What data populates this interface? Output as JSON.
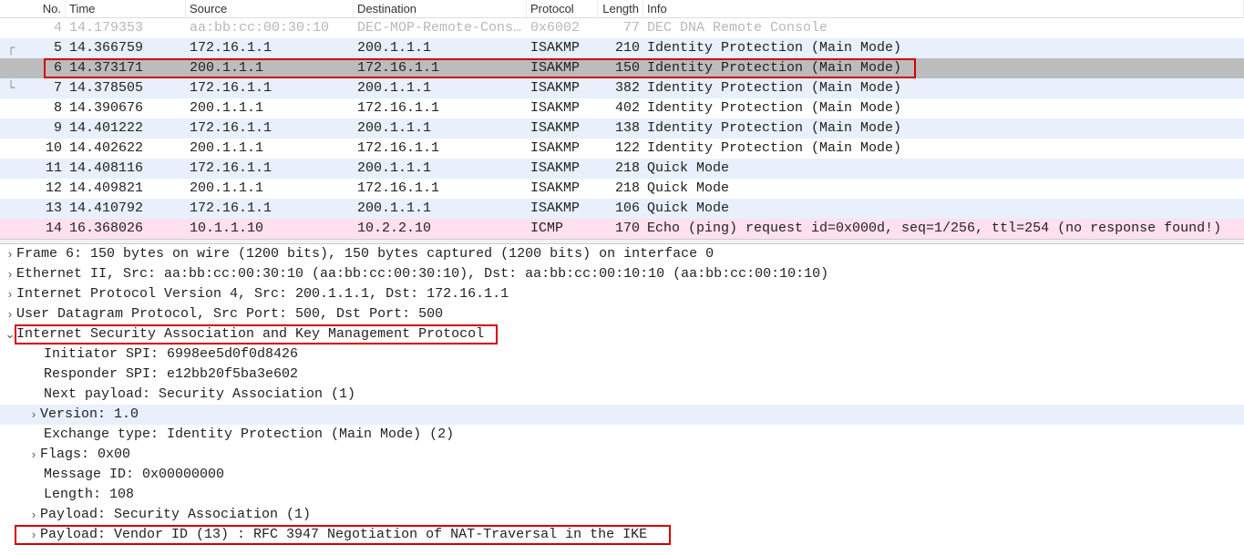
{
  "columns": {
    "no": "No.",
    "time": "Time",
    "src": "Source",
    "dst": "Destination",
    "proto": "Protocol",
    "len": "Length",
    "info": "Info"
  },
  "packets": [
    {
      "no": "4",
      "time": "14.179353",
      "src": "aa:bb:cc:00:30:10",
      "dst": "DEC-MOP-Remote-Cons…",
      "proto": "0x6002",
      "len": "77",
      "info": "DEC DNA Remote Console",
      "style": "dim",
      "margin": ""
    },
    {
      "no": "5",
      "time": "14.366759",
      "src": "172.16.1.1",
      "dst": "200.1.1.1",
      "proto": "ISAKMP",
      "len": "210",
      "info": "Identity Protection (Main Mode)",
      "style": "blue",
      "margin": "┌"
    },
    {
      "no": "6",
      "time": "14.373171",
      "src": "200.1.1.1",
      "dst": "172.16.1.1",
      "proto": "ISAKMP",
      "len": "150",
      "info": "Identity Protection (Main Mode)",
      "style": "sel",
      "margin": "",
      "boxed": true
    },
    {
      "no": "7",
      "time": "14.378505",
      "src": "172.16.1.1",
      "dst": "200.1.1.1",
      "proto": "ISAKMP",
      "len": "382",
      "info": "Identity Protection (Main Mode)",
      "style": "blue",
      "margin": "└"
    },
    {
      "no": "8",
      "time": "14.390676",
      "src": "200.1.1.1",
      "dst": "172.16.1.1",
      "proto": "ISAKMP",
      "len": "402",
      "info": "Identity Protection (Main Mode)",
      "style": "white",
      "margin": ""
    },
    {
      "no": "9",
      "time": "14.401222",
      "src": "172.16.1.1",
      "dst": "200.1.1.1",
      "proto": "ISAKMP",
      "len": "138",
      "info": "Identity Protection (Main Mode)",
      "style": "blue",
      "margin": ""
    },
    {
      "no": "10",
      "time": "14.402622",
      "src": "200.1.1.1",
      "dst": "172.16.1.1",
      "proto": "ISAKMP",
      "len": "122",
      "info": "Identity Protection (Main Mode)",
      "style": "white",
      "margin": ""
    },
    {
      "no": "11",
      "time": "14.408116",
      "src": "172.16.1.1",
      "dst": "200.1.1.1",
      "proto": "ISAKMP",
      "len": "218",
      "info": "Quick Mode",
      "style": "blue",
      "margin": ""
    },
    {
      "no": "12",
      "time": "14.409821",
      "src": "200.1.1.1",
      "dst": "172.16.1.1",
      "proto": "ISAKMP",
      "len": "218",
      "info": "Quick Mode",
      "style": "white",
      "margin": ""
    },
    {
      "no": "13",
      "time": "14.410792",
      "src": "172.16.1.1",
      "dst": "200.1.1.1",
      "proto": "ISAKMP",
      "len": "106",
      "info": "Quick Mode",
      "style": "blue",
      "margin": ""
    },
    {
      "no": "14",
      "time": "16.368026",
      "src": "10.1.1.10",
      "dst": "10.2.2.10",
      "proto": "ICMP",
      "len": "170",
      "info": "Echo (ping) request  id=0x000d, seq=1/256, ttl=254 (no response found!)",
      "style": "pink",
      "margin": ""
    }
  ],
  "details": [
    {
      "indent": 0,
      "chev": "›",
      "text": "Frame 6: 150 bytes on wire (1200 bits), 150 bytes captured (1200 bits) on interface 0"
    },
    {
      "indent": 0,
      "chev": "›",
      "text": "Ethernet II, Src: aa:bb:cc:00:30:10 (aa:bb:cc:00:30:10), Dst: aa:bb:cc:00:10:10 (aa:bb:cc:00:10:10)"
    },
    {
      "indent": 0,
      "chev": "›",
      "text": "Internet Protocol Version 4, Src: 200.1.1.1, Dst: 172.16.1.1"
    },
    {
      "indent": 0,
      "chev": "›",
      "text": "User Datagram Protocol, Src Port: 500, Dst Port: 500"
    },
    {
      "indent": 0,
      "chev": "v",
      "text": "Internet Security Association and Key Management Protocol",
      "box": "isakmp"
    },
    {
      "indent": 2,
      "chev": "",
      "text": "Initiator SPI: 6998ee5d0f0d8426"
    },
    {
      "indent": 2,
      "chev": "",
      "text": "Responder SPI: e12bb20f5ba3e602"
    },
    {
      "indent": 2,
      "chev": "",
      "text": "Next payload: Security Association (1)"
    },
    {
      "indent": 1,
      "chev": "›",
      "text": "Version: 1.0",
      "hl": true
    },
    {
      "indent": 2,
      "chev": "",
      "text": "Exchange type: Identity Protection (Main Mode) (2)"
    },
    {
      "indent": 1,
      "chev": "›",
      "text": "Flags: 0x00"
    },
    {
      "indent": 2,
      "chev": "",
      "text": "Message ID: 0x00000000"
    },
    {
      "indent": 2,
      "chev": "",
      "text": "Length: 108"
    },
    {
      "indent": 1,
      "chev": "›",
      "text": "Payload: Security Association (1)"
    },
    {
      "indent": 1,
      "chev": "›",
      "text": "Payload: Vendor ID (13) : RFC 3947 Negotiation of NAT-Traversal in the IKE",
      "box": "vendor"
    }
  ]
}
